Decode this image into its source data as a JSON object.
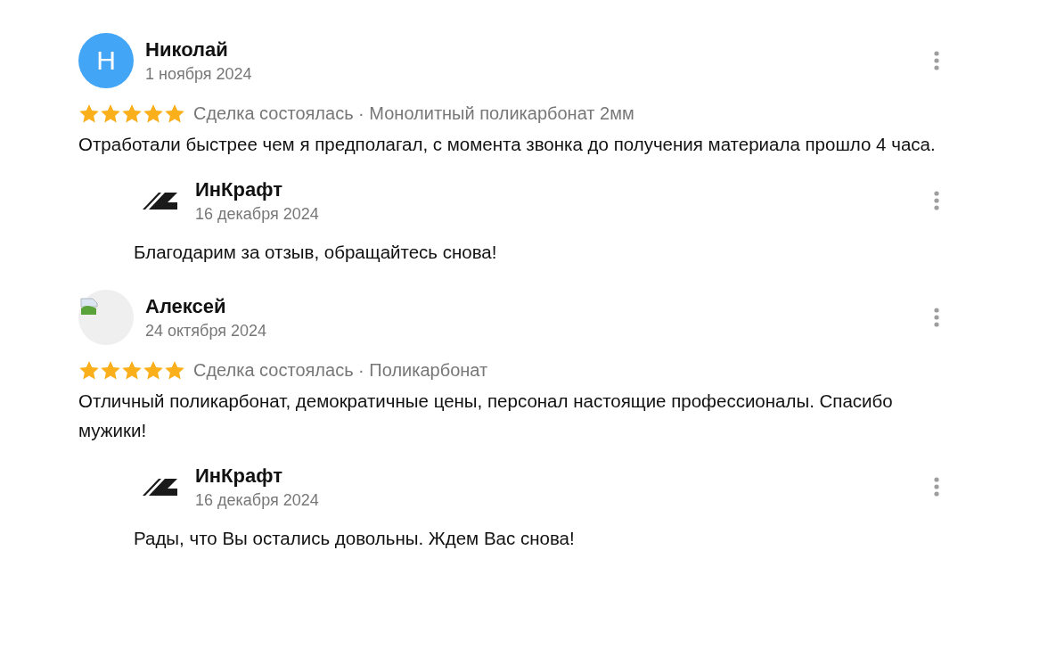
{
  "reviews": [
    {
      "author": "Николай",
      "avatar": {
        "kind": "letter",
        "letter": "Н",
        "color": "#42a5f5"
      },
      "date": "1 ноября 2024",
      "stars": 5,
      "meta": "Сделка состоялась · Монолитный поликарбонат 2мм",
      "text": "Отработали быстрее чем я предполагал, с момента звонка до получения материала прошло 4 часа.",
      "reply": {
        "author": "ИнКрафт",
        "date": "16 декабря 2024",
        "text": "Благодарим за отзыв, обращайтесь снова!"
      }
    },
    {
      "author": "Алексей",
      "avatar": {
        "kind": "broken-image"
      },
      "date": "24 октября 2024",
      "stars": 5,
      "meta": "Сделка состоялась · Поликарбонат",
      "text": "Отличный поликарбонат, демократичные цены, персонал настоящие профессионалы. Спасибо мужики!",
      "reply": {
        "author": "ИнКрафт",
        "date": "16 декабря 2024",
        "text": "Рады, что Вы остались довольны. Ждем Вас снова!"
      }
    }
  ]
}
